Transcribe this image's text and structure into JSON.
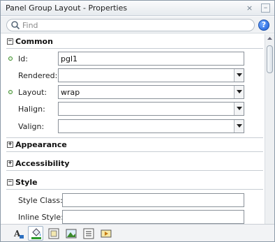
{
  "window": {
    "title": "Panel Group Layout - Properties",
    "close_glyph": "×",
    "minimize_glyph": "–"
  },
  "search": {
    "placeholder": "Find",
    "value": "",
    "help_glyph": "?"
  },
  "sections": {
    "common": {
      "title": "Common",
      "toggle": "−",
      "expanded": true,
      "fields": {
        "id": {
          "label": "Id:",
          "value": "pgl1",
          "required": true
        },
        "rendered": {
          "label": "Rendered:",
          "value": ""
        },
        "layout": {
          "label": "Layout:",
          "value": "wrap",
          "required": true
        },
        "halign": {
          "label": "Halign:",
          "value": ""
        },
        "valign": {
          "label": "Valign:",
          "value": ""
        }
      }
    },
    "appearance": {
      "title": "Appearance",
      "toggle": "+",
      "expanded": false
    },
    "accessibility": {
      "title": "Accessibility",
      "toggle": "+",
      "expanded": false
    },
    "style": {
      "title": "Style",
      "toggle": "−",
      "expanded": true,
      "fields": {
        "style_class": {
          "label": "Style Class:",
          "value": ""
        },
        "inline_style": {
          "label": "Inline Style:",
          "value": ""
        }
      }
    }
  },
  "toolbar": {
    "buttons": [
      "text-style-icon",
      "color-fill-icon",
      "box-model-icon",
      "image-background-icon",
      "list-layout-icon",
      "media-icon"
    ],
    "active_index": 1
  },
  "colors": {
    "required_marker": "#3b8a2a",
    "help_blue": "#1d5ed8",
    "border": "#8c9aa8"
  }
}
